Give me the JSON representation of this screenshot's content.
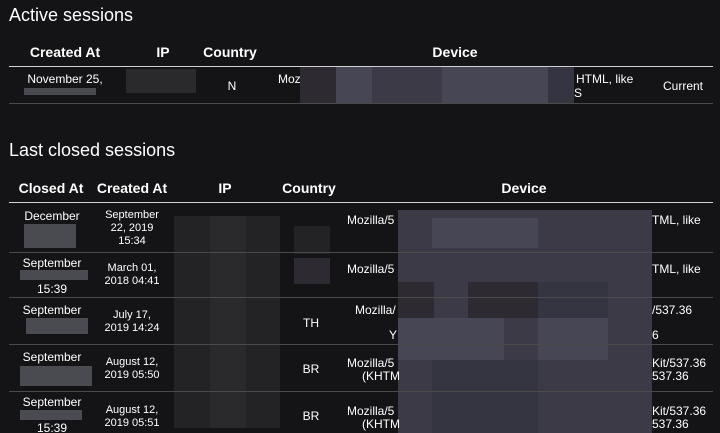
{
  "active": {
    "title": "Active sessions",
    "columns": [
      "Created At",
      "IP",
      "Country",
      "Device"
    ],
    "row": {
      "created_at": "November 25,",
      "country": "N",
      "device_left": "Moz",
      "device_right_1": "HTML, like",
      "device_right_2": "S",
      "status": "Current"
    }
  },
  "closed": {
    "title": "Last closed sessions",
    "columns": [
      "Closed At",
      "Created At",
      "IP",
      "Country",
      "Device"
    ],
    "rows": [
      {
        "closed_at": "December",
        "closed_at_extra": "",
        "created_at_1": "September",
        "created_at_2": "22, 2019",
        "created_at_3": "15:34",
        "country": "...",
        "device_left_1": "Mozilla/5",
        "device_left_2": "",
        "device_right_1": "TML, like",
        "device_right_2": ""
      },
      {
        "closed_at": "September",
        "closed_at_extra": "15:39",
        "created_at_1": "March 01,",
        "created_at_2": "2018 04:41",
        "created_at_3": "",
        "country": "",
        "device_left_1": "Mozilla/5",
        "device_left_2": "",
        "device_right_1": "TML, like",
        "device_right_2": ""
      },
      {
        "closed_at": "September",
        "closed_at_extra": "",
        "created_at_1": "July 17,",
        "created_at_2": "2019 14:24",
        "created_at_3": "",
        "country": "TH",
        "device_left_1": "Mozilla/",
        "device_left_2": "Y",
        "device_right_1": "/537.36",
        "device_right_2": "6"
      },
      {
        "closed_at": "September",
        "closed_at_extra": "",
        "created_at_1": "August 12,",
        "created_at_2": "2019 05:50",
        "created_at_3": "",
        "country": "BR",
        "device_left_1": "Mozilla/5",
        "device_left_2": "(KHTM",
        "device_right_1": "Kit/537.36",
        "device_right_2": "537.36"
      },
      {
        "closed_at": "September",
        "closed_at_extra": "15:39",
        "created_at_1": "August 12,",
        "created_at_2": "2019 05:51",
        "created_at_3": "",
        "country": "BR",
        "device_left_1": "Mozilla/5",
        "device_left_2": "(KHTM",
        "device_right_1": "Kit/537.36",
        "device_right_2": "537.36"
      }
    ]
  }
}
